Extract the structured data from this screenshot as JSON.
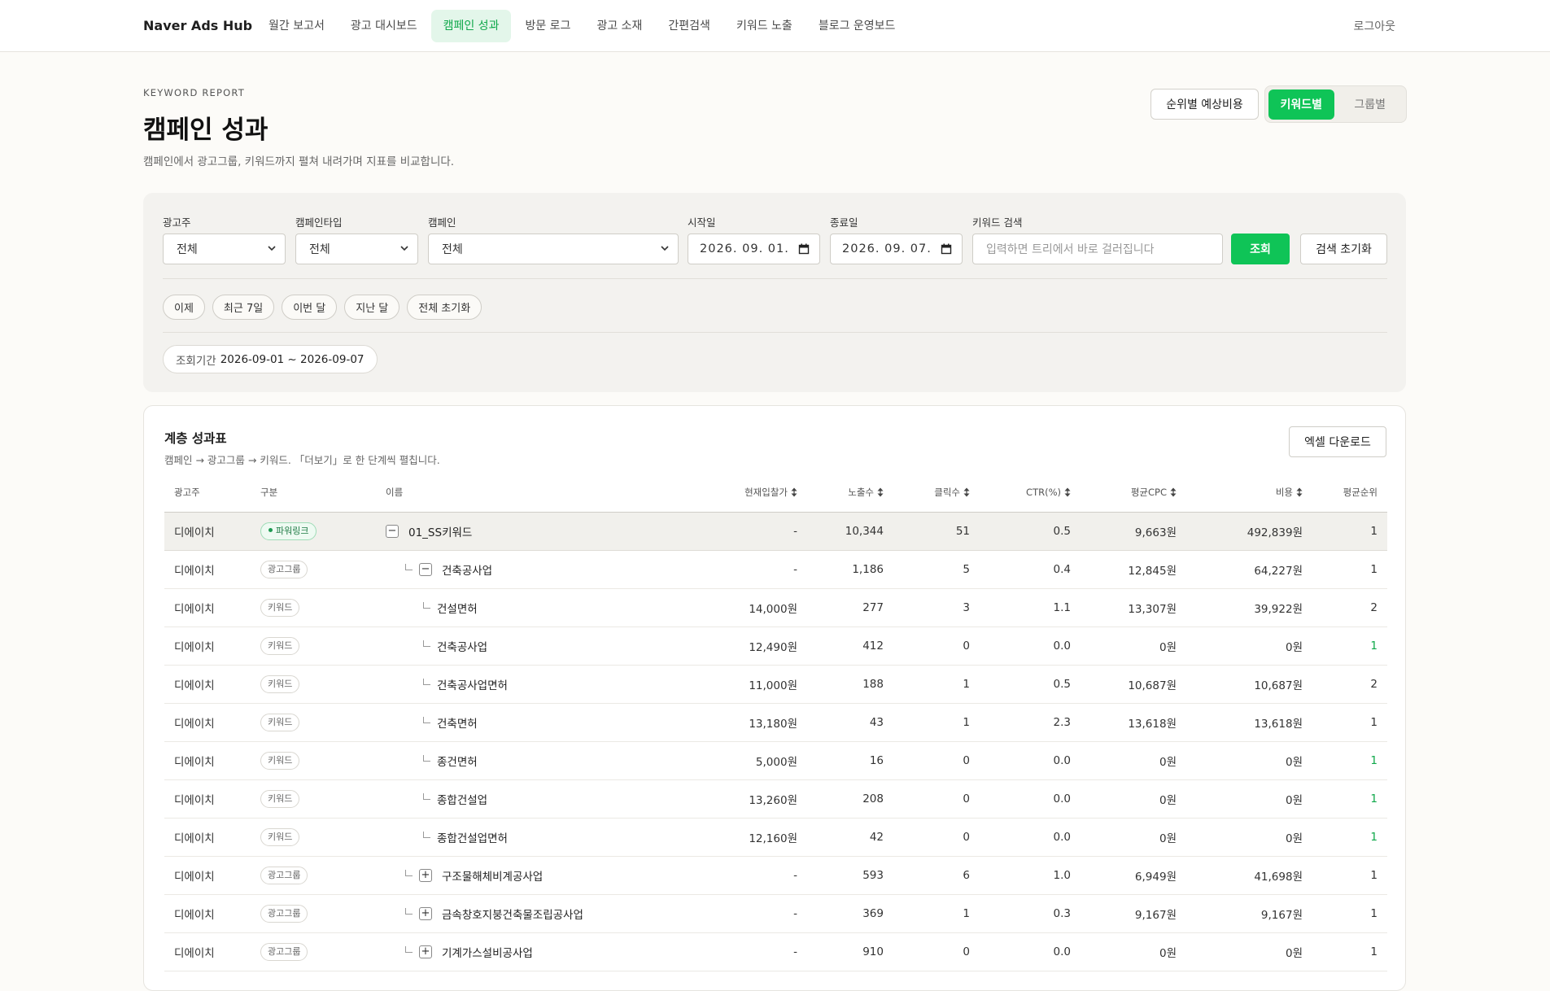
{
  "nav": {
    "brand": "Naver Ads Hub",
    "items": [
      {
        "label": "월간 보고서"
      },
      {
        "label": "광고 대시보드"
      },
      {
        "label": "캠페인 성과"
      },
      {
        "label": "방문 로그"
      },
      {
        "label": "광고 소재"
      },
      {
        "label": "간편검색"
      },
      {
        "label": "키워드 노출"
      },
      {
        "label": "블로그 운영보드"
      }
    ],
    "active_index": 2,
    "logout": "로그아웃"
  },
  "header": {
    "eyebrow": "KEYWORD REPORT",
    "title": "캠페인 성과",
    "description": "캠페인에서 광고그룹, 키워드까지 펼쳐 내려가며 지표를 비교합니다.",
    "forecast_button": "순위별 예상비용",
    "view_toggle": {
      "keyword": "키워드별",
      "group": "그룹별",
      "active": "keyword"
    }
  },
  "filters": {
    "advertiser": {
      "label": "광고주",
      "value": "전체"
    },
    "campaign_type": {
      "label": "캠페인타입",
      "value": "전체"
    },
    "campaign": {
      "label": "캠페인",
      "value": "전체"
    },
    "start_date": {
      "label": "시작일",
      "value": "2026. 09. 01."
    },
    "end_date": {
      "label": "종료일",
      "value": "2026. 09. 07."
    },
    "keyword_search": {
      "label": "키워드 검색",
      "placeholder": "입력하면 트리에서 바로 걸러집니다"
    },
    "query_button": "조회",
    "reset_button": "검색 초기화",
    "quick_ranges": [
      "이제",
      "최근 7일",
      "이번 달",
      "지난 달",
      "전체 초기화"
    ],
    "range_label": "조회기간",
    "range_value": "2026-09-01 ~ 2026-09-07"
  },
  "table_card": {
    "title": "계층 성과표",
    "description": "캠페인 → 광고그룹 → 키워드. 「더보기」로 한 단계씩 펼칩니다.",
    "excel_button": "엑셀 다운로드",
    "columns": {
      "advertiser": "광고주",
      "type": "구분",
      "name": "이름",
      "bid": "현재입찰가",
      "impressions": "노출수",
      "clicks": "클릭수",
      "ctr": "CTR(%)",
      "cpc": "평균CPC",
      "cost": "비용",
      "rank": "평균순위"
    },
    "rows": [
      {
        "advertiser": "디에이치",
        "type": "파워링크",
        "level": "campaign",
        "toggle": "−",
        "name": "01_SS키워드",
        "bid": "-",
        "impressions": "10,344",
        "clicks": "51",
        "ctr": "0.5",
        "cpc": "9,663원",
        "cost": "492,839원",
        "rank": "1"
      },
      {
        "advertiser": "디에이치",
        "type": "광고그룹",
        "level": "group",
        "toggle": "−",
        "name": "건축공사업",
        "bid": "-",
        "impressions": "1,186",
        "clicks": "5",
        "ctr": "0.4",
        "cpc": "12,845원",
        "cost": "64,227원",
        "rank": "1"
      },
      {
        "advertiser": "디에이치",
        "type": "키워드",
        "level": "keyword",
        "toggle": "",
        "name": "건설면허",
        "bid": "14,000원",
        "impressions": "277",
        "clicks": "3",
        "ctr": "1.1",
        "cpc": "13,307원",
        "cost": "39,922원",
        "rank": "2"
      },
      {
        "advertiser": "디에이치",
        "type": "키워드",
        "level": "keyword",
        "toggle": "",
        "name": "건축공사업",
        "bid": "12,490원",
        "impressions": "412",
        "clicks": "0",
        "ctr": "0.0",
        "cpc": "0원",
        "cost": "0원",
        "rank": "1"
      },
      {
        "advertiser": "디에이치",
        "type": "키워드",
        "level": "keyword",
        "toggle": "",
        "name": "건축공사업면허",
        "bid": "11,000원",
        "impressions": "188",
        "clicks": "1",
        "ctr": "0.5",
        "cpc": "10,687원",
        "cost": "10,687원",
        "rank": "2"
      },
      {
        "advertiser": "디에이치",
        "type": "키워드",
        "level": "keyword",
        "toggle": "",
        "name": "건축면허",
        "bid": "13,180원",
        "impressions": "43",
        "clicks": "1",
        "ctr": "2.3",
        "cpc": "13,618원",
        "cost": "13,618원",
        "rank": "1"
      },
      {
        "advertiser": "디에이치",
        "type": "키워드",
        "level": "keyword",
        "toggle": "",
        "name": "종건면허",
        "bid": "5,000원",
        "impressions": "16",
        "clicks": "0",
        "ctr": "0.0",
        "cpc": "0원",
        "cost": "0원",
        "rank": "1"
      },
      {
        "advertiser": "디에이치",
        "type": "키워드",
        "level": "keyword",
        "toggle": "",
        "name": "종합건설업",
        "bid": "13,260원",
        "impressions": "208",
        "clicks": "0",
        "ctr": "0.0",
        "cpc": "0원",
        "cost": "0원",
        "rank": "1"
      },
      {
        "advertiser": "디에이치",
        "type": "키워드",
        "level": "keyword",
        "toggle": "",
        "name": "종합건설업면허",
        "bid": "12,160원",
        "impressions": "42",
        "clicks": "0",
        "ctr": "0.0",
        "cpc": "0원",
        "cost": "0원",
        "rank": "1"
      },
      {
        "advertiser": "디에이치",
        "type": "광고그룹",
        "level": "group",
        "toggle": "+",
        "name": "구조물해체비계공사업",
        "bid": "-",
        "impressions": "593",
        "clicks": "6",
        "ctr": "1.0",
        "cpc": "6,949원",
        "cost": "41,698원",
        "rank": "1"
      },
      {
        "advertiser": "디에이치",
        "type": "광고그룹",
        "level": "group",
        "toggle": "+",
        "name": "금속창호지붕건축물조립공사업",
        "bid": "-",
        "impressions": "369",
        "clicks": "1",
        "ctr": "0.3",
        "cpc": "9,167원",
        "cost": "9,167원",
        "rank": "1"
      },
      {
        "advertiser": "디에이치",
        "type": "광고그룹",
        "level": "group",
        "toggle": "+",
        "name": "기계가스설비공사업",
        "bid": "-",
        "impressions": "910",
        "clicks": "0",
        "ctr": "0.0",
        "cpc": "0원",
        "cost": "0원",
        "rank": "1"
      }
    ]
  },
  "colors": {
    "accent": "#0fc457",
    "accent_text": "#0fa84a",
    "background": "#fcfbf8",
    "panel": "#f3f2ef"
  }
}
